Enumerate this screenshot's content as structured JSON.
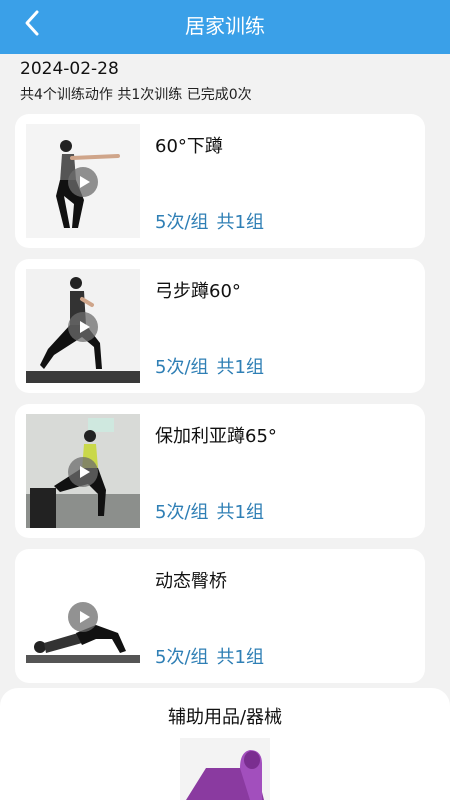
{
  "header": {
    "title": "居家训练",
    "back_icon": "chevron-left-icon"
  },
  "plan": {
    "date": "2024-02-28",
    "summary": "共4个训练动作  共1次训练 已完成0次"
  },
  "exercises": [
    {
      "name": "60°下蹲",
      "reps": "5次/组",
      "sets": "共1组"
    },
    {
      "name": "弓步蹲60°",
      "reps": "5次/组",
      "sets": "共1组"
    },
    {
      "name": "保加利亚蹲65°",
      "reps": "5次/组",
      "sets": "共1组"
    },
    {
      "name": "动态臀桥",
      "reps": "5次/组",
      "sets": "共1组"
    }
  ],
  "equipment": {
    "title": "辅助用品/器械",
    "item_icon": "yoga-mat"
  },
  "colors": {
    "header": "#3aa0e8",
    "accent_text": "#2f7fb5",
    "background": "#f2f2f2"
  }
}
